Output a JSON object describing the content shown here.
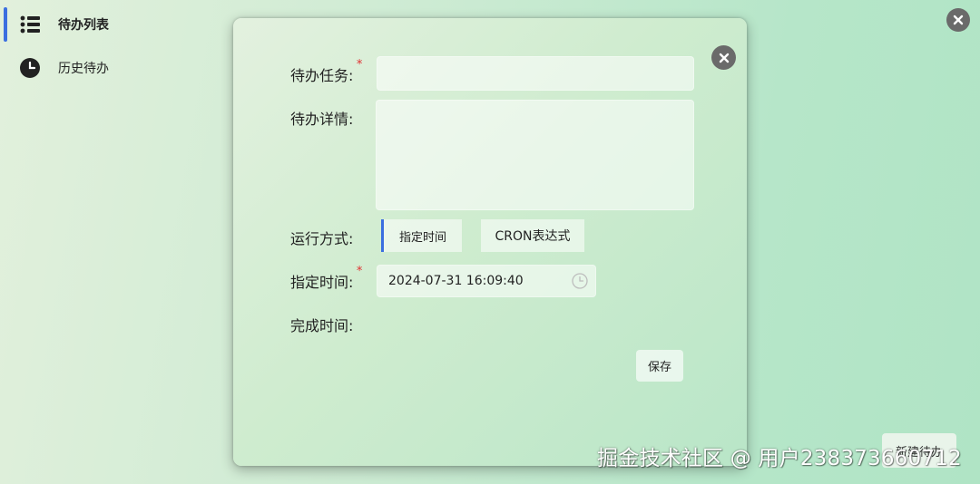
{
  "sidebar": {
    "items": [
      {
        "label": "待办列表",
        "icon": "list-icon",
        "active": true
      },
      {
        "label": "历史待办",
        "icon": "clock-icon",
        "active": false
      }
    ]
  },
  "main": {
    "new_task_label": "新建待办"
  },
  "dialog": {
    "task_label": "待办任务:",
    "detail_label": "待办详情:",
    "run_mode_label": "运行方式:",
    "run_modes": [
      {
        "label": "指定时间",
        "selected": true
      },
      {
        "label": "CRON表达式",
        "selected": false
      }
    ],
    "specified_time_label": "指定时间:",
    "specified_time_value": "2024-07-31 16:09:40",
    "complete_time_label": "完成时间:",
    "required_mark": "*",
    "save_label": "保存"
  },
  "watermark": "掘金技术社区 @ 用户2383736607​12",
  "colors": {
    "accent": "#3b6fe0",
    "required": "#e03131",
    "close_button": "#6a6a6a"
  }
}
